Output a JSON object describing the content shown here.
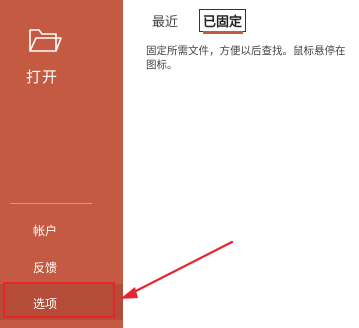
{
  "sidebar": {
    "open": {
      "icon": "folder-icon",
      "label": "打开"
    },
    "items": [
      {
        "label": "帐户"
      },
      {
        "label": "反馈"
      },
      {
        "label": "选项"
      }
    ],
    "background": "#c55a43",
    "selected_background": "#b54c37"
  },
  "main": {
    "tabs": [
      {
        "label": "最近"
      },
      {
        "label": "已固定"
      }
    ],
    "description": "固定所需文件，方便以后查找。鼠标悬停在\n图标。"
  },
  "annotation": {
    "highlight_color": "#e8242f",
    "icon": "arrow-icon"
  }
}
